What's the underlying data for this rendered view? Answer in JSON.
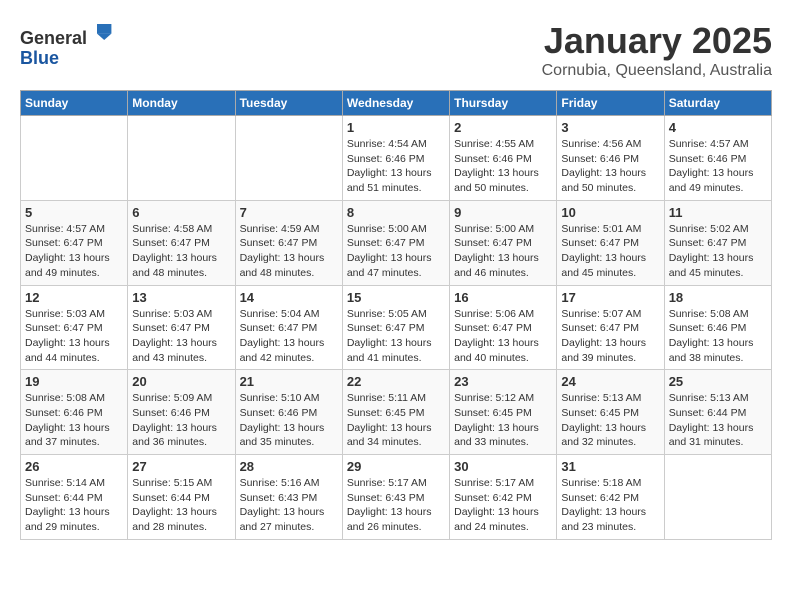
{
  "header": {
    "logo_line1": "General",
    "logo_line2": "Blue",
    "month_title": "January 2025",
    "location": "Cornubia, Queensland, Australia"
  },
  "weekdays": [
    "Sunday",
    "Monday",
    "Tuesday",
    "Wednesday",
    "Thursday",
    "Friday",
    "Saturday"
  ],
  "weeks": [
    [
      {
        "day": "",
        "sunrise": "",
        "sunset": "",
        "daylight": "",
        "empty": true
      },
      {
        "day": "",
        "sunrise": "",
        "sunset": "",
        "daylight": "",
        "empty": true
      },
      {
        "day": "",
        "sunrise": "",
        "sunset": "",
        "daylight": "",
        "empty": true
      },
      {
        "day": "1",
        "sunrise": "Sunrise: 4:54 AM",
        "sunset": "Sunset: 6:46 PM",
        "daylight": "Daylight: 13 hours and 51 minutes.",
        "empty": false
      },
      {
        "day": "2",
        "sunrise": "Sunrise: 4:55 AM",
        "sunset": "Sunset: 6:46 PM",
        "daylight": "Daylight: 13 hours and 50 minutes.",
        "empty": false
      },
      {
        "day": "3",
        "sunrise": "Sunrise: 4:56 AM",
        "sunset": "Sunset: 6:46 PM",
        "daylight": "Daylight: 13 hours and 50 minutes.",
        "empty": false
      },
      {
        "day": "4",
        "sunrise": "Sunrise: 4:57 AM",
        "sunset": "Sunset: 6:46 PM",
        "daylight": "Daylight: 13 hours and 49 minutes.",
        "empty": false
      }
    ],
    [
      {
        "day": "5",
        "sunrise": "Sunrise: 4:57 AM",
        "sunset": "Sunset: 6:47 PM",
        "daylight": "Daylight: 13 hours and 49 minutes.",
        "empty": false
      },
      {
        "day": "6",
        "sunrise": "Sunrise: 4:58 AM",
        "sunset": "Sunset: 6:47 PM",
        "daylight": "Daylight: 13 hours and 48 minutes.",
        "empty": false
      },
      {
        "day": "7",
        "sunrise": "Sunrise: 4:59 AM",
        "sunset": "Sunset: 6:47 PM",
        "daylight": "Daylight: 13 hours and 48 minutes.",
        "empty": false
      },
      {
        "day": "8",
        "sunrise": "Sunrise: 5:00 AM",
        "sunset": "Sunset: 6:47 PM",
        "daylight": "Daylight: 13 hours and 47 minutes.",
        "empty": false
      },
      {
        "day": "9",
        "sunrise": "Sunrise: 5:00 AM",
        "sunset": "Sunset: 6:47 PM",
        "daylight": "Daylight: 13 hours and 46 minutes.",
        "empty": false
      },
      {
        "day": "10",
        "sunrise": "Sunrise: 5:01 AM",
        "sunset": "Sunset: 6:47 PM",
        "daylight": "Daylight: 13 hours and 45 minutes.",
        "empty": false
      },
      {
        "day": "11",
        "sunrise": "Sunrise: 5:02 AM",
        "sunset": "Sunset: 6:47 PM",
        "daylight": "Daylight: 13 hours and 45 minutes.",
        "empty": false
      }
    ],
    [
      {
        "day": "12",
        "sunrise": "Sunrise: 5:03 AM",
        "sunset": "Sunset: 6:47 PM",
        "daylight": "Daylight: 13 hours and 44 minutes.",
        "empty": false
      },
      {
        "day": "13",
        "sunrise": "Sunrise: 5:03 AM",
        "sunset": "Sunset: 6:47 PM",
        "daylight": "Daylight: 13 hours and 43 minutes.",
        "empty": false
      },
      {
        "day": "14",
        "sunrise": "Sunrise: 5:04 AM",
        "sunset": "Sunset: 6:47 PM",
        "daylight": "Daylight: 13 hours and 42 minutes.",
        "empty": false
      },
      {
        "day": "15",
        "sunrise": "Sunrise: 5:05 AM",
        "sunset": "Sunset: 6:47 PM",
        "daylight": "Daylight: 13 hours and 41 minutes.",
        "empty": false
      },
      {
        "day": "16",
        "sunrise": "Sunrise: 5:06 AM",
        "sunset": "Sunset: 6:47 PM",
        "daylight": "Daylight: 13 hours and 40 minutes.",
        "empty": false
      },
      {
        "day": "17",
        "sunrise": "Sunrise: 5:07 AM",
        "sunset": "Sunset: 6:47 PM",
        "daylight": "Daylight: 13 hours and 39 minutes.",
        "empty": false
      },
      {
        "day": "18",
        "sunrise": "Sunrise: 5:08 AM",
        "sunset": "Sunset: 6:46 PM",
        "daylight": "Daylight: 13 hours and 38 minutes.",
        "empty": false
      }
    ],
    [
      {
        "day": "19",
        "sunrise": "Sunrise: 5:08 AM",
        "sunset": "Sunset: 6:46 PM",
        "daylight": "Daylight: 13 hours and 37 minutes.",
        "empty": false
      },
      {
        "day": "20",
        "sunrise": "Sunrise: 5:09 AM",
        "sunset": "Sunset: 6:46 PM",
        "daylight": "Daylight: 13 hours and 36 minutes.",
        "empty": false
      },
      {
        "day": "21",
        "sunrise": "Sunrise: 5:10 AM",
        "sunset": "Sunset: 6:46 PM",
        "daylight": "Daylight: 13 hours and 35 minutes.",
        "empty": false
      },
      {
        "day": "22",
        "sunrise": "Sunrise: 5:11 AM",
        "sunset": "Sunset: 6:45 PM",
        "daylight": "Daylight: 13 hours and 34 minutes.",
        "empty": false
      },
      {
        "day": "23",
        "sunrise": "Sunrise: 5:12 AM",
        "sunset": "Sunset: 6:45 PM",
        "daylight": "Daylight: 13 hours and 33 minutes.",
        "empty": false
      },
      {
        "day": "24",
        "sunrise": "Sunrise: 5:13 AM",
        "sunset": "Sunset: 6:45 PM",
        "daylight": "Daylight: 13 hours and 32 minutes.",
        "empty": false
      },
      {
        "day": "25",
        "sunrise": "Sunrise: 5:13 AM",
        "sunset": "Sunset: 6:44 PM",
        "daylight": "Daylight: 13 hours and 31 minutes.",
        "empty": false
      }
    ],
    [
      {
        "day": "26",
        "sunrise": "Sunrise: 5:14 AM",
        "sunset": "Sunset: 6:44 PM",
        "daylight": "Daylight: 13 hours and 29 minutes.",
        "empty": false
      },
      {
        "day": "27",
        "sunrise": "Sunrise: 5:15 AM",
        "sunset": "Sunset: 6:44 PM",
        "daylight": "Daylight: 13 hours and 28 minutes.",
        "empty": false
      },
      {
        "day": "28",
        "sunrise": "Sunrise: 5:16 AM",
        "sunset": "Sunset: 6:43 PM",
        "daylight": "Daylight: 13 hours and 27 minutes.",
        "empty": false
      },
      {
        "day": "29",
        "sunrise": "Sunrise: 5:17 AM",
        "sunset": "Sunset: 6:43 PM",
        "daylight": "Daylight: 13 hours and 26 minutes.",
        "empty": false
      },
      {
        "day": "30",
        "sunrise": "Sunrise: 5:17 AM",
        "sunset": "Sunset: 6:42 PM",
        "daylight": "Daylight: 13 hours and 24 minutes.",
        "empty": false
      },
      {
        "day": "31",
        "sunrise": "Sunrise: 5:18 AM",
        "sunset": "Sunset: 6:42 PM",
        "daylight": "Daylight: 13 hours and 23 minutes.",
        "empty": false
      },
      {
        "day": "",
        "sunrise": "",
        "sunset": "",
        "daylight": "",
        "empty": true
      }
    ]
  ]
}
